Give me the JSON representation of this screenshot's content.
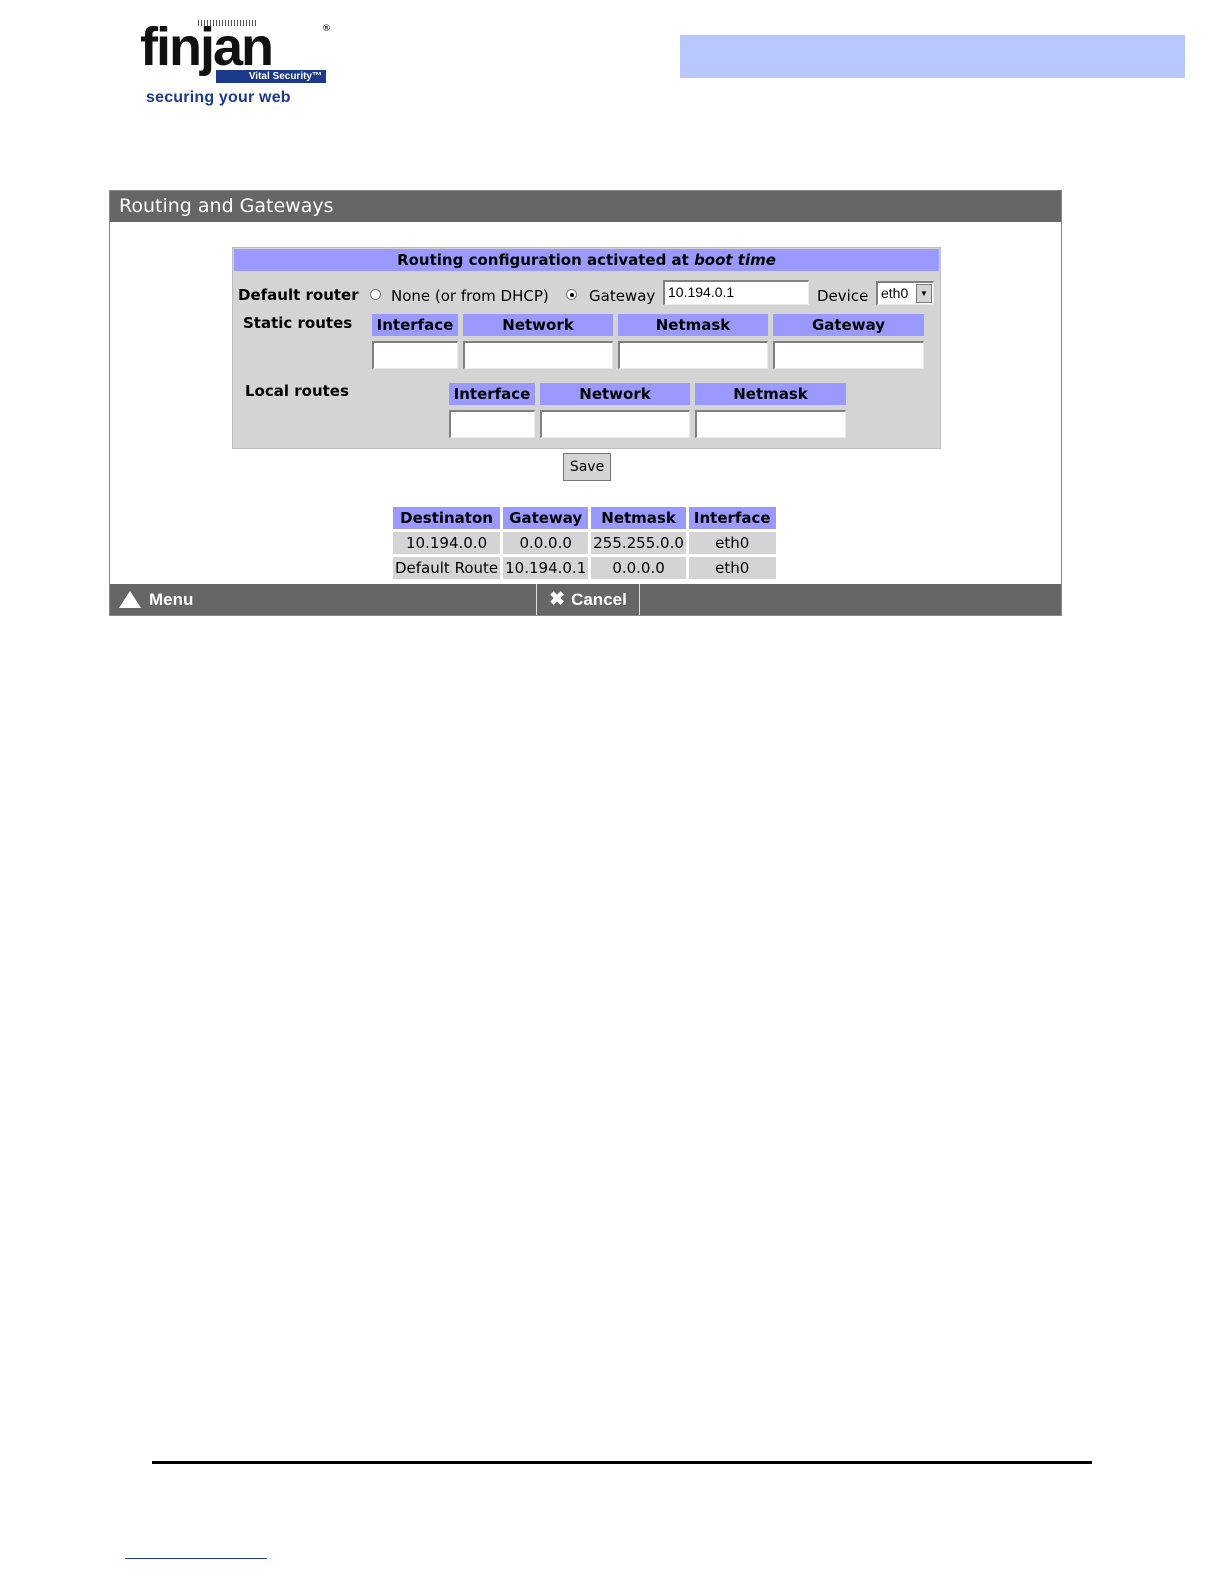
{
  "logo": {
    "word": "finjan",
    "tag": "Vital Security™",
    "slogan": "securing your web"
  },
  "window": {
    "title": "Routing and Gateways",
    "panel": {
      "heading_prefix": "Routing configuration activated at ",
      "heading_emph": "boot time",
      "default_router": {
        "label": "Default router",
        "option_none": "None (or from DHCP)",
        "option_gateway": "Gateway",
        "selected": "Gateway",
        "gateway_value": "10.194.0.1",
        "device_label": "Device",
        "device_value": "eth0"
      },
      "static_routes": {
        "label": "Static routes",
        "columns": [
          "Interface",
          "Network",
          "Netmask",
          "Gateway"
        ]
      },
      "local_routes": {
        "label": "Local routes",
        "columns": [
          "Interface",
          "Network",
          "Netmask"
        ]
      }
    },
    "save_label": "Save",
    "routes_table": {
      "headers": [
        "Destinaton",
        "Gateway",
        "Netmask",
        "Interface"
      ],
      "rows": [
        [
          "10.194.0.0",
          "0.0.0.0",
          "255.255.0.0",
          "eth0"
        ],
        [
          "Default Route",
          "10.194.0.1",
          "0.0.0.0",
          "eth0"
        ]
      ]
    },
    "footer": {
      "menu_label": "Menu",
      "cancel_label": "Cancel"
    }
  },
  "colors": {
    "header_bar": "#b8c8fc",
    "title_bar": "#666666",
    "panel_bg": "#d4d4d4",
    "column_header": "#9999ff",
    "brand_blue": "#1d3a8a"
  }
}
